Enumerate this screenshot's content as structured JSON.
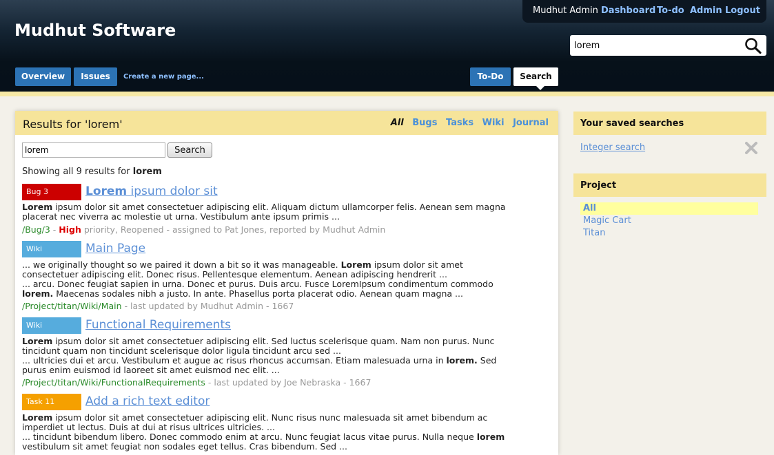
{
  "header": {
    "site_title": "Mudhut Software",
    "user": "Mudhut Admin",
    "links": [
      "Dashboard",
      "To-do",
      "Admin",
      "Logout"
    ],
    "search_value": "lorem",
    "tabs_left": [
      "Overview",
      "Issues"
    ],
    "create_page": "Create a new page...",
    "tabs_right": [
      "To-Do",
      "Search"
    ]
  },
  "main": {
    "title": "Results for 'lorem'",
    "filters": [
      "All",
      "Bugs",
      "Tasks",
      "Wiki",
      "Journal"
    ],
    "search_value": "lorem",
    "search_button": "Search",
    "showing_prefix": "Showing all 9 results for",
    "showing_term": "lorem",
    "results": [
      {
        "badge": "Bug 3",
        "badge_color": "#cc0000",
        "title_bold": "Lorem",
        "title_rest": " ipsum dolor sit",
        "lines": [
          [
            "Lorem",
            " ipsum dolor sit amet consectetuer adipiscing elit. Aliquam dictum ullamcorper felis. Aenean sem magna placerat nec viverra ac molestie ut urna. Vestibulum ante ipsum primis ..."
          ]
        ],
        "path": "/Bug/3",
        "sep": " - ",
        "priority": "High",
        "meta": " priority, Reopened - assigned to Pat Jones, reported by Mudhut Admin"
      },
      {
        "badge": "Wiki",
        "badge_color": "#56acdd",
        "title": "Main Page",
        "text1_pre": "... we originally thought so we paired it down a bit so it was manageable. ",
        "text1_bold": "Lorem",
        "text1_post": " ipsum dolor sit amet consectetuer adipiscing elit. Donec risus. Pellentesque elementum. Aenean adipiscing hendrerit ...",
        "text2_pre": "... arcu. Donec feugiat sapien in urna. Donec et purus. Duis arcu. Fusce LoremIpsum condimentum commodo ",
        "text2_bold": "lorem.",
        "text2_post": " Maecenas sodales nibh a justo. In ante. Phasellus porta placerat odio. Aenean quam magna ...",
        "path": "/Project/titan/Wiki/Main",
        "meta": " - last updated by Mudhut Admin - 1667"
      },
      {
        "badge": "Wiki",
        "badge_color": "#56acdd",
        "title": "Functional Requirements",
        "text1_bold": "Lorem",
        "text1_post": " ipsum dolor sit amet consectetuer adipiscing elit. Sed luctus scelerisque quam. Nam non purus. Nunc tincidunt quam non tincidunt scelerisque dolor ligula tincidunt arcu sed ...",
        "text2_pre": "... ultricies dui et arcu. Vestibulum et augue ac risus rhoncus accumsan. Etiam malesuada urna in ",
        "text2_bold": "lorem.",
        "text2_post": " Sed purus enim euismod id laoreet sit amet euismod nec elit. ...",
        "path": "/Project/titan/Wiki/FunctionalRequirements",
        "meta": " - last updated by Joe Nebraska - 1667"
      },
      {
        "badge": "Task 11",
        "badge_color": "#f5a000",
        "title": "Add a rich text editor",
        "text1_bold": "Lorem",
        "text1_post": " ipsum dolor sit amet consectetuer adipiscing elit. Nunc risus nunc malesuada sit amet bibendum ac imperdiet ut lectus. Duis at dui at risus ultrices ultricies. ...",
        "text2_pre": "... tincidunt bibendum libero. Donec commodo enim at arcu. Nunc feugiat lacus vitae purus. Nulla neque ",
        "text2_bold": "lorem",
        "text2_post": " vestibulum sit amet feugiat non sodales eget tellus. Cras bibendum. Sed ..."
      }
    ]
  },
  "sidebar": {
    "saved_title": "Your saved searches",
    "saved_item": "Integer search",
    "project_title": "Project",
    "projects": [
      "All",
      "Magic Cart",
      "Titan"
    ]
  }
}
